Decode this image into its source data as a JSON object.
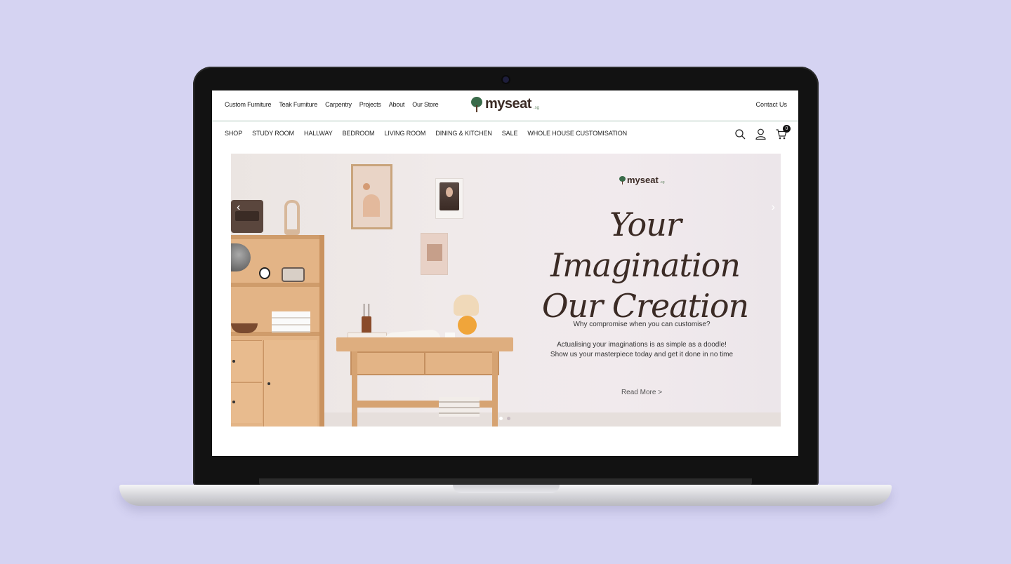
{
  "top_links": [
    "Custom Furniture",
    "Teak Furniture",
    "Carpentry",
    "Projects",
    "About",
    "Our Store"
  ],
  "logo": {
    "text": "myseat",
    "suffix": ".sg"
  },
  "contact": "Contact Us",
  "main_nav": [
    "SHOP",
    "STUDY ROOM",
    "HALLWAY",
    "BEDROOM",
    "LIVING ROOM",
    "DINING & KITCHEN",
    "SALE",
    "WHOLE HOUSE CUSTOMISATION"
  ],
  "cart_count": "0",
  "hero": {
    "logo_text": "myseat",
    "logo_suffix": ".sg",
    "headline_line1": "Your Imagination",
    "headline_line2": "Our Creation",
    "subtitle": "Why compromise when you can customise?",
    "body_line1": "Actualising your imaginations is as simple as a doodle!",
    "body_line2": "Show us your masterpiece today and get it done in no time",
    "cta": "Read More >",
    "prev_arrow": "‹",
    "next_arrow": "›",
    "slides": 2,
    "active_slide": 1
  },
  "icons": [
    "search-icon",
    "user-icon",
    "cart-icon"
  ],
  "colors": {
    "background": "#d5d3f2",
    "brand_dark": "#3b2b25",
    "brand_green": "#3a6b4a"
  }
}
